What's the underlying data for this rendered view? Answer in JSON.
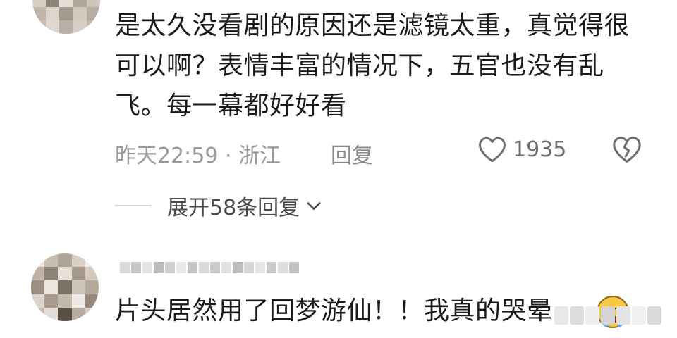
{
  "comment_1": {
    "text": "是太久没看剧的原因还是滤镜太重，真觉得很可以啊？表情丰富的情况下，五官也没有乱飞。每一幕都好好看",
    "time_location": "昨天22:59 · 浙江",
    "reply_label": "回复",
    "like_count": "1935",
    "like_icon": "heart-outline-icon",
    "dislike_icon": "broken-heart-icon"
  },
  "expand": {
    "label": "展开58条回复",
    "icon": "chevron-down-icon"
  },
  "comment_2": {
    "text": "片头居然用了回梦游仙！！我真的哭晕",
    "emoji": "crying-face-emoji"
  },
  "colors": {
    "text": "#1b1b1b",
    "meta": "#9a9a9a",
    "expand": "#4a4a4a",
    "icon": "#6f6f6f"
  }
}
